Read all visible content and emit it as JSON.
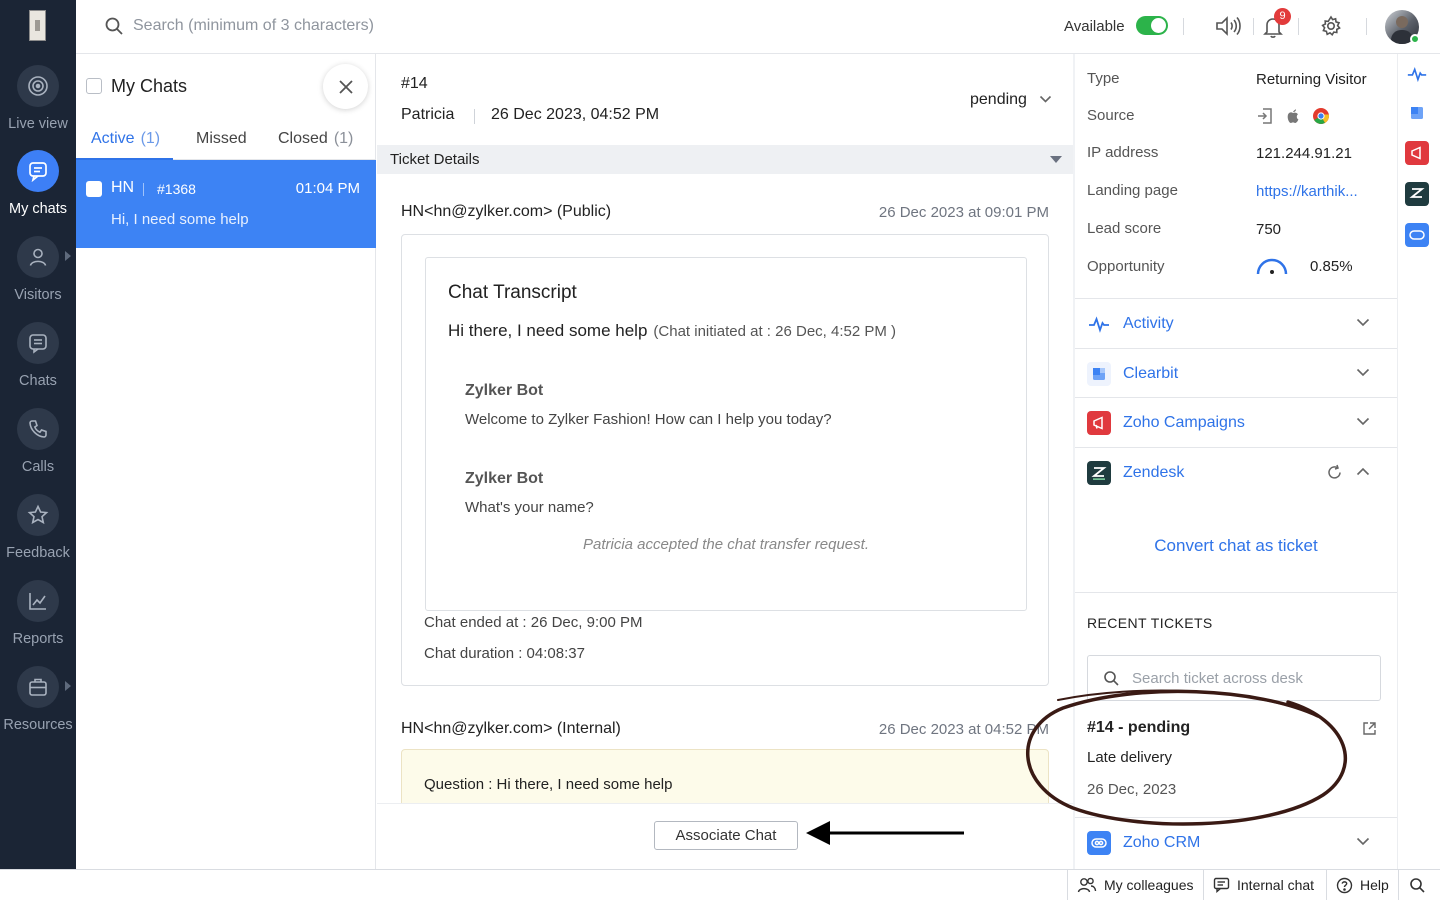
{
  "nav": {
    "items": [
      {
        "label": "Live view",
        "icon": "live-view-icon"
      },
      {
        "label": "My chats",
        "icon": "chat-bubble-icon"
      },
      {
        "label": "Visitors",
        "icon": "person-icon"
      },
      {
        "label": "Chats",
        "icon": "chats-icon"
      },
      {
        "label": "Calls",
        "icon": "phone-icon"
      },
      {
        "label": "Feedback",
        "icon": "star-icon"
      },
      {
        "label": "Reports",
        "icon": "chart-icon"
      },
      {
        "label": "Resources",
        "icon": "briefcase-icon"
      }
    ],
    "active_index": 1
  },
  "topbar": {
    "search_placeholder": "Search (minimum of 3 characters)",
    "status_label": "Available",
    "notification_count": "9"
  },
  "chat_list": {
    "title": "My Chats",
    "tabs": [
      {
        "label": "Active",
        "count": "(1)"
      },
      {
        "label": "Missed",
        "count": ""
      },
      {
        "label": "Closed",
        "count": "(1)"
      }
    ],
    "items": [
      {
        "name": "HN",
        "number": "#1368",
        "time": "01:04 PM",
        "message": "Hi, I need some help"
      }
    ]
  },
  "ticket": {
    "number": "#14",
    "owner": "Patricia",
    "date": "26 Dec 2023, 04:52 PM",
    "status": "pending",
    "section_title": "Ticket Details",
    "public_msg": {
      "from": "HN<hn@zylker.com> (Public)",
      "date": "26 Dec 2023 at 09:01 PM",
      "transcript_title": "Chat Transcript",
      "first_message": "Hi there, I need some help",
      "first_meta": "(Chat initiated at : 26 Dec, 4:52 PM )",
      "bot_messages": [
        {
          "sender": "Zylker Bot",
          "text": "Welcome to Zylker Fashion! How can I help you today?"
        },
        {
          "sender": "Zylker Bot",
          "text": "What's your name?"
        }
      ],
      "system_note": "Patricia accepted the chat transfer request.",
      "ended_at": "Chat ended at : 26 Dec, 9:00 PM",
      "duration": "Chat duration : 04:08:37"
    },
    "internal_msg": {
      "from": "HN<hn@zylker.com> (Internal)",
      "date": "26 Dec 2023 at 04:52 PM",
      "question": "Question : Hi there, I need some help"
    },
    "associate_label": "Associate Chat"
  },
  "visitor_info": {
    "fields": [
      {
        "label": "Type",
        "value": "Returning Visitor"
      },
      {
        "label": "Source",
        "value": ""
      },
      {
        "label": "IP address",
        "value": "121.244.91.21"
      },
      {
        "label": "Landing page",
        "value": "https://karthik..."
      },
      {
        "label": "Lead score",
        "value": "750"
      },
      {
        "label": "Opportunity",
        "value": "0.85%"
      }
    ]
  },
  "integrations": [
    {
      "label": "Activity",
      "icon": "activity-icon",
      "color": "#2f73e8"
    },
    {
      "label": "Clearbit",
      "icon": "clearbit-icon",
      "color": "#3d83f4"
    },
    {
      "label": "Zoho Campaigns",
      "icon": "zoho-campaigns-icon",
      "color": "#e0393e"
    },
    {
      "label": "Zendesk",
      "icon": "zendesk-icon",
      "color": "#1f3b3f"
    },
    {
      "label": "Zoho CRM",
      "icon": "zoho-crm-icon",
      "color": "#3d83f4"
    }
  ],
  "zendesk": {
    "convert_label": "Convert chat as ticket",
    "recent_title": "RECENT TICKETS",
    "search_placeholder": "Search ticket across desk",
    "recent": {
      "number_status": "#14 - pending",
      "subject": "Late delivery",
      "date": "26 Dec, 2023"
    }
  },
  "bottombar": {
    "colleagues": "My colleagues",
    "internal_chat": "Internal chat",
    "help": "Help"
  },
  "colors": {
    "nav_bg": "#1b2535",
    "accent": "#3d83f4",
    "link": "#2f73e8",
    "available": "#2cb34a",
    "badge": "#e23b3b",
    "annotation": "#3a1a14"
  }
}
